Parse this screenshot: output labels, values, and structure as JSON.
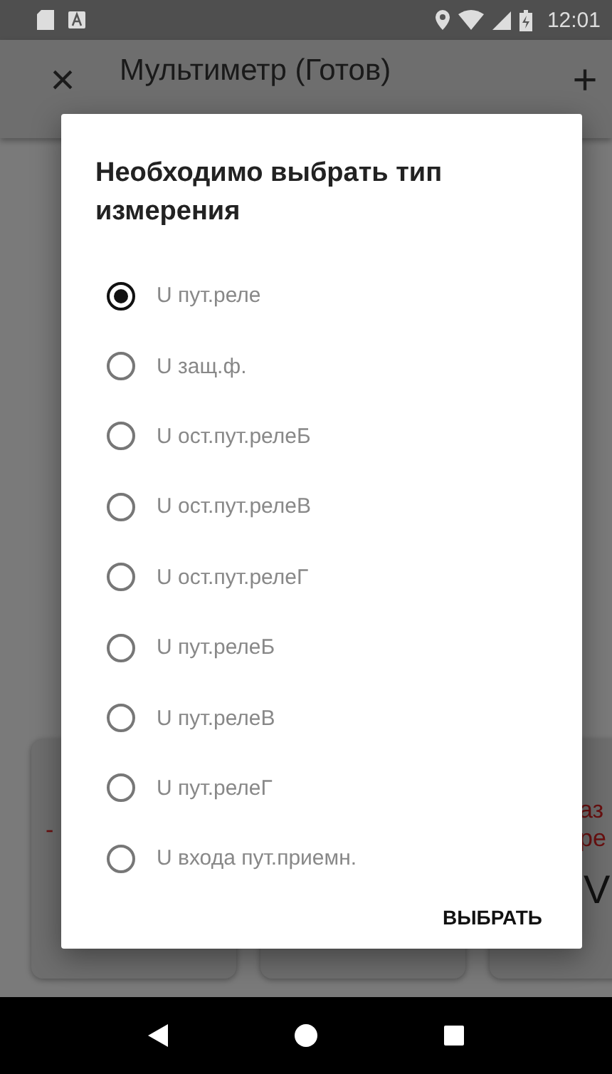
{
  "status_bar": {
    "time": "12:01"
  },
  "app_bar": {
    "title": "Мультиметр (Готов)",
    "close_icon": "×",
    "add_icon": "+"
  },
  "background_cards": [
    {
      "kind": "panel",
      "texts": [
        {
          "kind": "red",
          "text": "-"
        }
      ]
    },
    {
      "kind": "panel"
    },
    {
      "kind": "panel",
      "texts": [
        {
          "kind": "red",
          "text": "аз"
        },
        {
          "kind": "red",
          "text": "ре"
        },
        {
          "kind": "big",
          "text": "V"
        }
      ]
    }
  ],
  "dialog": {
    "title": "Необходимо выбрать тип измерения",
    "options": [
      {
        "label": "U пут.реле",
        "selected": true
      },
      {
        "label": "U защ.ф.",
        "selected": false
      },
      {
        "label": "U ост.пут.релеБ",
        "selected": false
      },
      {
        "label": "U ост.пут.релеВ",
        "selected": false
      },
      {
        "label": "U ост.пут.релеГ",
        "selected": false
      },
      {
        "label": "U пут.релеБ",
        "selected": false
      },
      {
        "label": "U пут.релеВ",
        "selected": false
      },
      {
        "label": "U пут.релеГ",
        "selected": false
      },
      {
        "label": "U входа пут.приемн.",
        "selected": false
      }
    ],
    "button": "ВЫБРАТЬ"
  }
}
